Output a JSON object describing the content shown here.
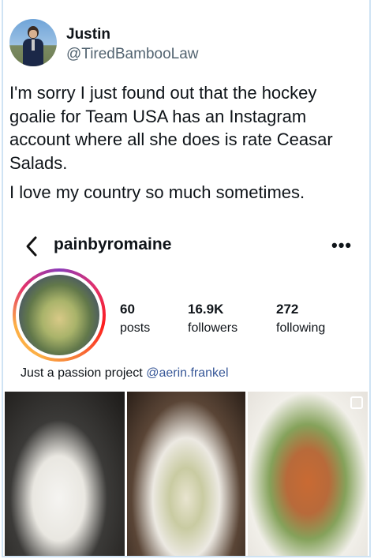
{
  "tweet": {
    "author_name": "Justin",
    "author_handle": "@TiredBambooLaw",
    "paragraphs": [
      "I'm sorry I just found out that the hockey goalie for Team USA has an Instagram account where all she does is rate Ceasar Salads.",
      "I love my country so much sometimes."
    ]
  },
  "instagram": {
    "username": "painbyromaine",
    "stats": [
      {
        "value": "60",
        "label": "posts"
      },
      {
        "value": "16.9K",
        "label": "followers"
      },
      {
        "value": "272",
        "label": "following"
      }
    ],
    "bio_text": "Just a passion project",
    "bio_mention": "@aerin.frankel",
    "icons": {
      "back": "chevron-left-icon",
      "more": "more-options-icon",
      "multi": "multiple-photos-icon"
    },
    "more_glyph": "•••"
  }
}
